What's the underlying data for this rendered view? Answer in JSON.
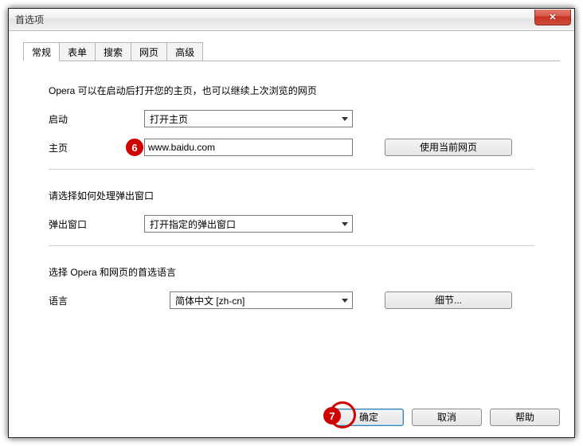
{
  "window": {
    "title": "首选项"
  },
  "tabs": {
    "general": "常规",
    "forms": "表单",
    "search": "搜索",
    "webpage": "网页",
    "advanced": "高级"
  },
  "startup": {
    "desc": "Opera 可以在启动后打开您的主页，也可以继续上次浏览的网页",
    "startup_label": "启动",
    "startup_option": "打开主页",
    "homepage_label": "主页",
    "homepage_value": "www.baidu.com",
    "use_current_btn": "使用当前网页"
  },
  "popup": {
    "desc": "请选择如何处理弹出窗口",
    "label": "弹出窗口",
    "option": "打开指定的弹出窗口"
  },
  "language": {
    "desc": "选择 Opera 和网页的首选语言",
    "label": "语言",
    "option": "简体中文 [zh-cn]",
    "details_btn": "细节..."
  },
  "footer": {
    "ok": "确定",
    "cancel": "取消",
    "help": "帮助"
  },
  "annotations": {
    "a6": "6",
    "a7": "7"
  }
}
